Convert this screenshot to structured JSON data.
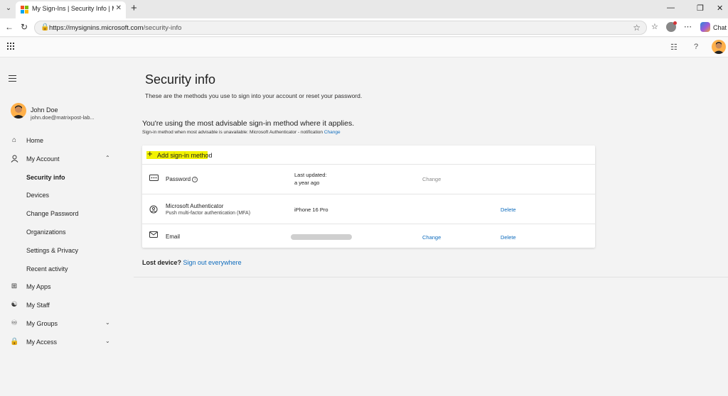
{
  "browser": {
    "tab_title": "My Sign-Ins | Security Info | Microsoft",
    "url_host": "https://mysignins.microsoft.com",
    "url_path": "/security-info",
    "chat_label": "Chat"
  },
  "colors": {
    "accent": "#0f6cbd",
    "highlight": "#f2f200"
  },
  "sidebar": {
    "user": {
      "name": "John Doe",
      "email": "john.doe@matrixpost-lab..."
    },
    "items": [
      {
        "label": "Home",
        "icon": "home-icon"
      },
      {
        "label": "My Account",
        "icon": "person-icon",
        "expanded": true
      },
      {
        "label": "Security info",
        "selected": true
      },
      {
        "label": "Devices"
      },
      {
        "label": "Change Password"
      },
      {
        "label": "Organizations"
      },
      {
        "label": "Settings & Privacy"
      },
      {
        "label": "Recent activity"
      },
      {
        "label": "My Apps",
        "icon": "apps-icon"
      },
      {
        "label": "My Staff",
        "icon": "staff-icon"
      },
      {
        "label": "My Groups",
        "icon": "groups-icon",
        "expandable": true
      },
      {
        "label": "My Access",
        "icon": "lock-icon",
        "expandable": true
      }
    ]
  },
  "main": {
    "title": "Security info",
    "subtitle": "These are the methods you use to sign into your account or reset your password.",
    "advisable_heading": "You're using the most advisable sign-in method where it applies.",
    "advisable_note": "Sign-in method when most advisable is unavailable: Microsoft Authenticator - notification",
    "advisable_change": "Change",
    "add_method_label": "Add sign-in method",
    "methods": [
      {
        "name": "Password",
        "icon": "password-icon",
        "detail_label": "Last updated:",
        "detail_value": "a year ago",
        "change": "Change"
      },
      {
        "name": "Microsoft Authenticator",
        "sub": "Push multi-factor authentication (MFA)",
        "icon": "authenticator-icon",
        "detail": "iPhone 16 Pro",
        "delete": "Delete"
      },
      {
        "name": "Email",
        "icon": "mail-icon",
        "change": "Change",
        "delete": "Delete"
      }
    ],
    "lost_device": "Lost device?",
    "sign_out_everywhere": "Sign out everywhere"
  }
}
